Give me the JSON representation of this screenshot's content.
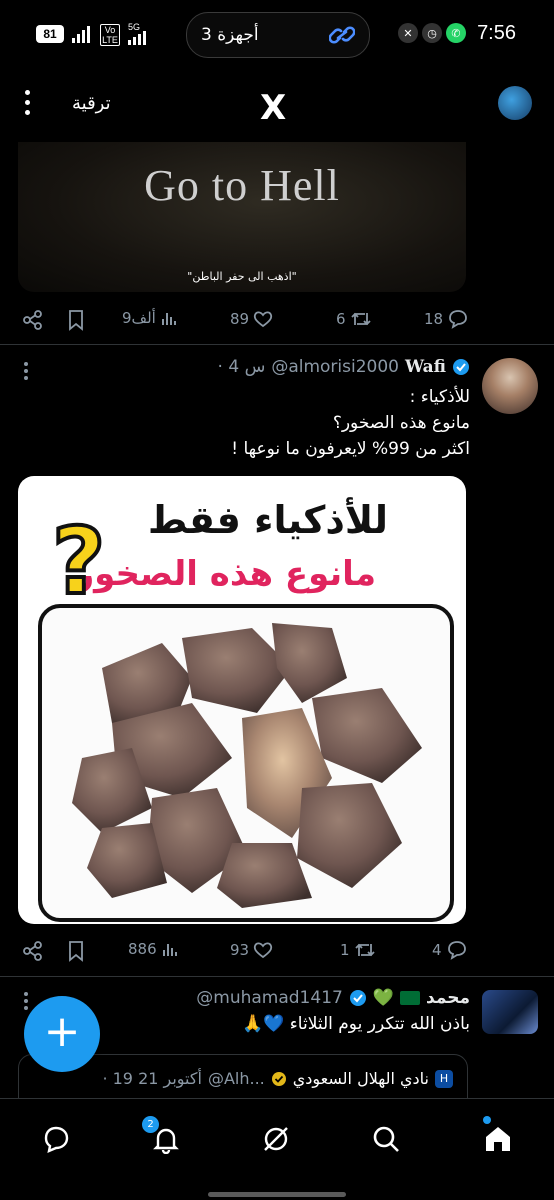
{
  "status_bar": {
    "time": "7:56",
    "devices_pill": "3 أجهزة",
    "battery": "81",
    "network_tag": "5G",
    "volte_tag": "Vo LTE"
  },
  "header": {
    "upgrade_label": "ترقية",
    "logo": "X"
  },
  "tweet1": {
    "media_caption": "Go to Hell",
    "media_subtitle": "\"اذهب الى حفر الباطن\"",
    "replies": "18",
    "reposts": "6",
    "likes": "89",
    "views": "9ألف"
  },
  "tweet2": {
    "name": "Wafi",
    "handle": "@almorisi2000",
    "time": "· 4 س",
    "body_line1": "للأذكياء :",
    "body_line2": "مانوع هذه الصخور؟",
    "body_line3": "اكثر من 99% لايعرفون ما نوعها !",
    "image_title1": "للأذكياء فقط",
    "image_title2": "مانوع هذه الصخور",
    "image_qmark": "?",
    "replies": "4",
    "reposts": "1",
    "likes": "93",
    "views": "886"
  },
  "tweet3": {
    "name": "محمد",
    "handle": "@muhamad1417",
    "body": "باذن الله تتكرر يوم الثلاثاء 💙🙏",
    "quote_name": "نادي الهلال السعودي",
    "quote_handle": "@Alh...",
    "quote_date": "· 19 أكتوبر 21"
  },
  "fab_label": "+",
  "nav": {
    "notifications_badge": "2"
  },
  "colors": {
    "accent": "#1d9bf0",
    "verified": "#1d9bf0",
    "muted": "#8b98a5",
    "divider": "#2f3336",
    "image_title_pink": "#e0245e",
    "qmark_yellow": "#f7d21b"
  }
}
